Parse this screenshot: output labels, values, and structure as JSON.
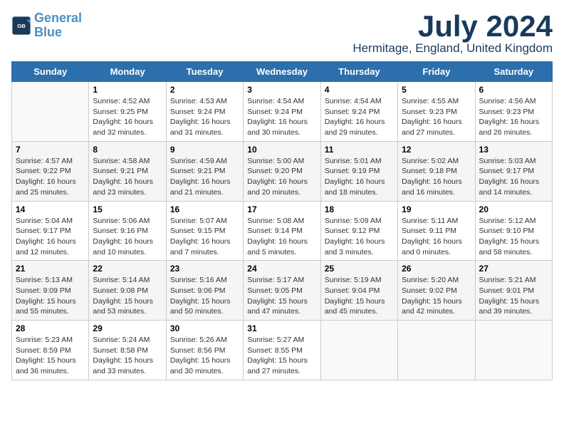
{
  "header": {
    "logo_line1": "General",
    "logo_line2": "Blue",
    "title": "July 2024",
    "subtitle": "Hermitage, England, United Kingdom"
  },
  "days_of_week": [
    "Sunday",
    "Monday",
    "Tuesday",
    "Wednesday",
    "Thursday",
    "Friday",
    "Saturday"
  ],
  "weeks": [
    {
      "days": [
        {
          "date": "",
          "sunrise": "",
          "sunset": "",
          "daylight": ""
        },
        {
          "date": "1",
          "sunrise": "Sunrise: 4:52 AM",
          "sunset": "Sunset: 9:25 PM",
          "daylight": "Daylight: 16 hours and 32 minutes."
        },
        {
          "date": "2",
          "sunrise": "Sunrise: 4:53 AM",
          "sunset": "Sunset: 9:24 PM",
          "daylight": "Daylight: 16 hours and 31 minutes."
        },
        {
          "date": "3",
          "sunrise": "Sunrise: 4:54 AM",
          "sunset": "Sunset: 9:24 PM",
          "daylight": "Daylight: 16 hours and 30 minutes."
        },
        {
          "date": "4",
          "sunrise": "Sunrise: 4:54 AM",
          "sunset": "Sunset: 9:24 PM",
          "daylight": "Daylight: 16 hours and 29 minutes."
        },
        {
          "date": "5",
          "sunrise": "Sunrise: 4:55 AM",
          "sunset": "Sunset: 9:23 PM",
          "daylight": "Daylight: 16 hours and 27 minutes."
        },
        {
          "date": "6",
          "sunrise": "Sunrise: 4:56 AM",
          "sunset": "Sunset: 9:23 PM",
          "daylight": "Daylight: 16 hours and 26 minutes."
        }
      ]
    },
    {
      "days": [
        {
          "date": "7",
          "sunrise": "Sunrise: 4:57 AM",
          "sunset": "Sunset: 9:22 PM",
          "daylight": "Daylight: 16 hours and 25 minutes."
        },
        {
          "date": "8",
          "sunrise": "Sunrise: 4:58 AM",
          "sunset": "Sunset: 9:21 PM",
          "daylight": "Daylight: 16 hours and 23 minutes."
        },
        {
          "date": "9",
          "sunrise": "Sunrise: 4:59 AM",
          "sunset": "Sunset: 9:21 PM",
          "daylight": "Daylight: 16 hours and 21 minutes."
        },
        {
          "date": "10",
          "sunrise": "Sunrise: 5:00 AM",
          "sunset": "Sunset: 9:20 PM",
          "daylight": "Daylight: 16 hours and 20 minutes."
        },
        {
          "date": "11",
          "sunrise": "Sunrise: 5:01 AM",
          "sunset": "Sunset: 9:19 PM",
          "daylight": "Daylight: 16 hours and 18 minutes."
        },
        {
          "date": "12",
          "sunrise": "Sunrise: 5:02 AM",
          "sunset": "Sunset: 9:18 PM",
          "daylight": "Daylight: 16 hours and 16 minutes."
        },
        {
          "date": "13",
          "sunrise": "Sunrise: 5:03 AM",
          "sunset": "Sunset: 9:17 PM",
          "daylight": "Daylight: 16 hours and 14 minutes."
        }
      ]
    },
    {
      "days": [
        {
          "date": "14",
          "sunrise": "Sunrise: 5:04 AM",
          "sunset": "Sunset: 9:17 PM",
          "daylight": "Daylight: 16 hours and 12 minutes."
        },
        {
          "date": "15",
          "sunrise": "Sunrise: 5:06 AM",
          "sunset": "Sunset: 9:16 PM",
          "daylight": "Daylight: 16 hours and 10 minutes."
        },
        {
          "date": "16",
          "sunrise": "Sunrise: 5:07 AM",
          "sunset": "Sunset: 9:15 PM",
          "daylight": "Daylight: 16 hours and 7 minutes."
        },
        {
          "date": "17",
          "sunrise": "Sunrise: 5:08 AM",
          "sunset": "Sunset: 9:14 PM",
          "daylight": "Daylight: 16 hours and 5 minutes."
        },
        {
          "date": "18",
          "sunrise": "Sunrise: 5:09 AM",
          "sunset": "Sunset: 9:12 PM",
          "daylight": "Daylight: 16 hours and 3 minutes."
        },
        {
          "date": "19",
          "sunrise": "Sunrise: 5:11 AM",
          "sunset": "Sunset: 9:11 PM",
          "daylight": "Daylight: 16 hours and 0 minutes."
        },
        {
          "date": "20",
          "sunrise": "Sunrise: 5:12 AM",
          "sunset": "Sunset: 9:10 PM",
          "daylight": "Daylight: 15 hours and 58 minutes."
        }
      ]
    },
    {
      "days": [
        {
          "date": "21",
          "sunrise": "Sunrise: 5:13 AM",
          "sunset": "Sunset: 9:09 PM",
          "daylight": "Daylight: 15 hours and 55 minutes."
        },
        {
          "date": "22",
          "sunrise": "Sunrise: 5:14 AM",
          "sunset": "Sunset: 9:08 PM",
          "daylight": "Daylight: 15 hours and 53 minutes."
        },
        {
          "date": "23",
          "sunrise": "Sunrise: 5:16 AM",
          "sunset": "Sunset: 9:06 PM",
          "daylight": "Daylight: 15 hours and 50 minutes."
        },
        {
          "date": "24",
          "sunrise": "Sunrise: 5:17 AM",
          "sunset": "Sunset: 9:05 PM",
          "daylight": "Daylight: 15 hours and 47 minutes."
        },
        {
          "date": "25",
          "sunrise": "Sunrise: 5:19 AM",
          "sunset": "Sunset: 9:04 PM",
          "daylight": "Daylight: 15 hours and 45 minutes."
        },
        {
          "date": "26",
          "sunrise": "Sunrise: 5:20 AM",
          "sunset": "Sunset: 9:02 PM",
          "daylight": "Daylight: 15 hours and 42 minutes."
        },
        {
          "date": "27",
          "sunrise": "Sunrise: 5:21 AM",
          "sunset": "Sunset: 9:01 PM",
          "daylight": "Daylight: 15 hours and 39 minutes."
        }
      ]
    },
    {
      "days": [
        {
          "date": "28",
          "sunrise": "Sunrise: 5:23 AM",
          "sunset": "Sunset: 8:59 PM",
          "daylight": "Daylight: 15 hours and 36 minutes."
        },
        {
          "date": "29",
          "sunrise": "Sunrise: 5:24 AM",
          "sunset": "Sunset: 8:58 PM",
          "daylight": "Daylight: 15 hours and 33 minutes."
        },
        {
          "date": "30",
          "sunrise": "Sunrise: 5:26 AM",
          "sunset": "Sunset: 8:56 PM",
          "daylight": "Daylight: 15 hours and 30 minutes."
        },
        {
          "date": "31",
          "sunrise": "Sunrise: 5:27 AM",
          "sunset": "Sunset: 8:55 PM",
          "daylight": "Daylight: 15 hours and 27 minutes."
        },
        {
          "date": "",
          "sunrise": "",
          "sunset": "",
          "daylight": ""
        },
        {
          "date": "",
          "sunrise": "",
          "sunset": "",
          "daylight": ""
        },
        {
          "date": "",
          "sunrise": "",
          "sunset": "",
          "daylight": ""
        }
      ]
    }
  ]
}
